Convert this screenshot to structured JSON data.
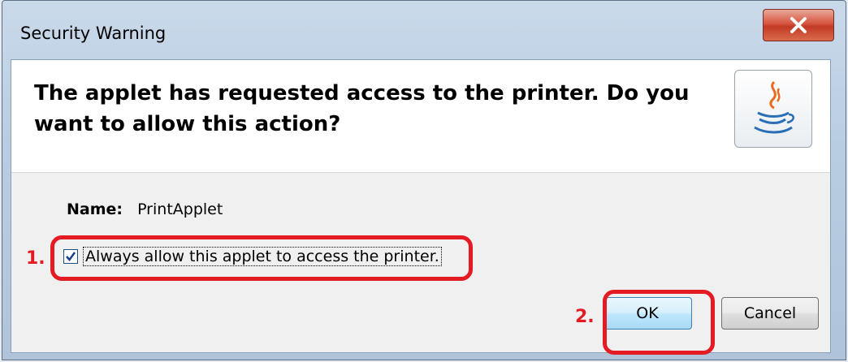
{
  "window": {
    "title": "Security Warning"
  },
  "dialog": {
    "headline": "The applet has requested access to the printer. Do you want to allow this action?",
    "name_label": "Name:",
    "name_value": "PrintApplet",
    "checkbox_label": "Always allow this applet to access the printer.",
    "checkbox_checked": true,
    "ok_label": "OK",
    "cancel_label": "Cancel",
    "icon": "java-coffee-icon"
  },
  "annotations": {
    "step1": "1.",
    "step2": "2.",
    "color": "#e51b24"
  }
}
